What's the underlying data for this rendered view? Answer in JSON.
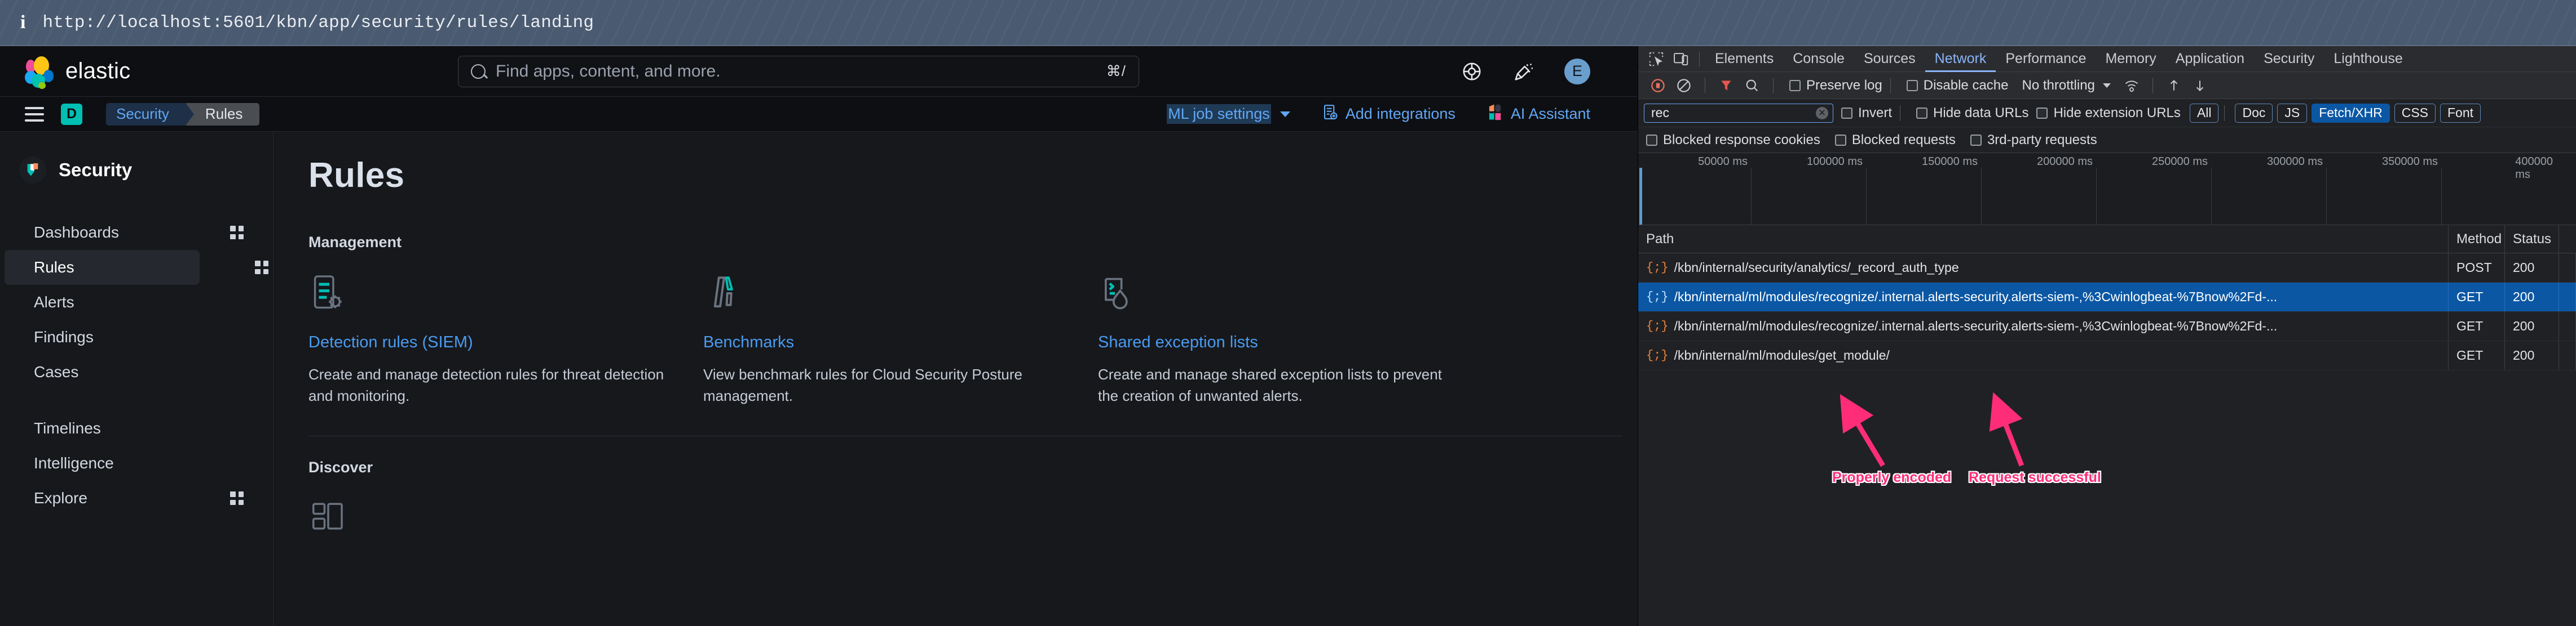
{
  "urlbar": {
    "info_icon": "info-icon",
    "url": "http://localhost:5601/kbn/app/security/rules/landing"
  },
  "elastic_header": {
    "brand": "elastic",
    "search": {
      "placeholder": "Find apps, content, and more.",
      "shortcut": "⌘/"
    },
    "icons": [
      "help-ring-icon",
      "whats-new-icon"
    ],
    "avatar_initial": "E"
  },
  "nav": {
    "menu_icon": "hamburger-icon",
    "space_initial": "D",
    "breadcrumbs": [
      "Security",
      "Rules"
    ],
    "right_links": [
      {
        "label": "ML job settings",
        "icon": "chevron-down-icon"
      },
      {
        "label": "Add integrations",
        "icon": "add-integrations-icon"
      },
      {
        "label": "AI Assistant",
        "icon": "ai-assistant-icon"
      }
    ]
  },
  "sidebar": {
    "title": "Security",
    "items": [
      {
        "label": "Dashboards",
        "has_grid": true,
        "active": false
      },
      {
        "label": "Rules",
        "has_grid": true,
        "active": true
      },
      {
        "label": "Alerts",
        "has_grid": false,
        "active": false
      },
      {
        "label": "Findings",
        "has_grid": false,
        "active": false
      },
      {
        "label": "Cases",
        "has_grid": false,
        "active": false
      },
      {
        "label": "Timelines",
        "has_grid": false,
        "active": false
      },
      {
        "label": "Intelligence",
        "has_grid": false,
        "active": false
      },
      {
        "label": "Explore",
        "has_grid": true,
        "active": false
      }
    ]
  },
  "content": {
    "page_title": "Rules",
    "management_label": "Management",
    "cards": [
      {
        "icon": "detection-rules-icon",
        "title": "Detection rules (SIEM)",
        "description": "Create and manage detection rules for threat detection and monitoring."
      },
      {
        "icon": "benchmarks-icon",
        "title": "Benchmarks",
        "description": "View benchmark rules for Cloud Security Posture management."
      },
      {
        "icon": "shared-exception-lists-icon",
        "title": "Shared exception lists",
        "description": "Create and manage shared exception lists to prevent the creation of unwanted alerts."
      }
    ],
    "discover_label": "Discover",
    "discover_icon": "discover-card-icon"
  },
  "devtools": {
    "left_icons": [
      "inspect-element-icon",
      "device-toolbar-icon"
    ],
    "tabs": [
      {
        "label": "Elements",
        "active": false
      },
      {
        "label": "Console",
        "active": false
      },
      {
        "label": "Sources",
        "active": false
      },
      {
        "label": "Network",
        "active": true
      },
      {
        "label": "Performance",
        "active": false
      },
      {
        "label": "Memory",
        "active": false
      },
      {
        "label": "Application",
        "active": false
      },
      {
        "label": "Security",
        "active": false
      },
      {
        "label": "Lighthouse",
        "active": false
      }
    ],
    "toolbar": {
      "record_icon": "record-stop-icon",
      "clear_icon": "clear-network-icon",
      "filter_icon": "filter-funnel-icon",
      "search_icon": "search-icon",
      "preserve_log": "Preserve log",
      "disable_cache": "Disable cache",
      "throttling": "No throttling",
      "throttle_settings_icon": "network-conditions-icon",
      "import_icon": "import-har-icon",
      "export_icon": "export-har-icon"
    },
    "filterbar": {
      "filter_value": "rec",
      "clear_icon": "clear-filter-icon",
      "invert": "Invert",
      "hide_data_urls": "Hide data URLs",
      "hide_extension_urls": "Hide extension URLs",
      "types": [
        {
          "label": "All",
          "active": false
        },
        {
          "label": "Doc",
          "active": false
        },
        {
          "label": "JS",
          "active": false
        },
        {
          "label": "Fetch/XHR",
          "active": true
        },
        {
          "label": "CSS",
          "active": false
        },
        {
          "label": "Font",
          "active": false
        }
      ]
    },
    "blockedbar": {
      "blocked_response_cookies": "Blocked response cookies",
      "blocked_requests": "Blocked requests",
      "third_party_requests": "3rd-party requests"
    },
    "overview": {
      "ticks": [
        "50000 ms",
        "100000 ms",
        "150000 ms",
        "200000 ms",
        "250000 ms",
        "300000 ms",
        "350000 ms",
        "400000 ms"
      ]
    },
    "table": {
      "columns": [
        "Path",
        "Method",
        "Status"
      ],
      "rows": [
        {
          "icon": "json-file-icon",
          "path": "/kbn/internal/security/analytics/_record_auth_type",
          "method": "POST",
          "status": "200",
          "selected": false
        },
        {
          "icon": "json-file-icon",
          "path": "/kbn/internal/ml/modules/recognize/.internal.alerts-security.alerts-siem-,%3Cwinlogbeat-%7Bnow%2Fd-...",
          "method": "GET",
          "status": "200",
          "selected": true
        },
        {
          "icon": "json-file-icon",
          "path": "/kbn/internal/ml/modules/recognize/.internal.alerts-security.alerts-siem-,%3Cwinlogbeat-%7Bnow%2Fd-...",
          "method": "GET",
          "status": "200",
          "selected": false
        },
        {
          "icon": "json-file-icon",
          "path": "/kbn/internal/ml/modules/get_module/",
          "method": "GET",
          "status": "200",
          "selected": false
        }
      ]
    },
    "annotations": [
      {
        "text": "Properly encoded",
        "color": "#ff2d78"
      },
      {
        "text": "Request successful",
        "color": "#ff2d78"
      }
    ]
  }
}
